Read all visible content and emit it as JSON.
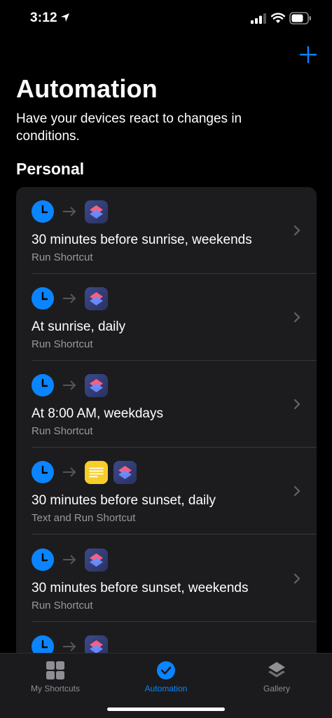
{
  "status_bar": {
    "time": "3:12"
  },
  "header": {
    "title": "Automation",
    "subtitle": "Have your devices react to changes in conditions.",
    "section": "Personal"
  },
  "colors": {
    "accent": "#0a84ff",
    "background": "#000000",
    "card": "#1c1c1e",
    "secondary_text": "#98989f"
  },
  "automations": [
    {
      "title": "30 minutes before sunrise, weekends",
      "subtitle": "Run Shortcut",
      "icons": [
        "clock-icon",
        "shortcuts-icon"
      ]
    },
    {
      "title": "At sunrise, daily",
      "subtitle": "Run Shortcut",
      "icons": [
        "clock-icon",
        "shortcuts-icon"
      ]
    },
    {
      "title": "At 8:00 AM, weekdays",
      "subtitle": "Run Shortcut",
      "icons": [
        "clock-icon",
        "shortcuts-icon"
      ]
    },
    {
      "title": "30 minutes before sunset, daily",
      "subtitle": "Text and Run Shortcut",
      "icons": [
        "clock-icon",
        "notes-icon",
        "shortcuts-icon"
      ]
    },
    {
      "title": "30 minutes before sunset, weekends",
      "subtitle": "Run Shortcut",
      "icons": [
        "clock-icon",
        "shortcuts-icon"
      ]
    },
    {
      "title": "",
      "subtitle": "",
      "icons": [
        "clock-icon",
        "shortcuts-icon"
      ]
    }
  ],
  "tabs": [
    {
      "label": "My Shortcuts",
      "icon": "grid-icon",
      "active": false
    },
    {
      "label": "Automation",
      "icon": "clock-check-icon",
      "active": true
    },
    {
      "label": "Gallery",
      "icon": "layers-icon",
      "active": false
    }
  ]
}
